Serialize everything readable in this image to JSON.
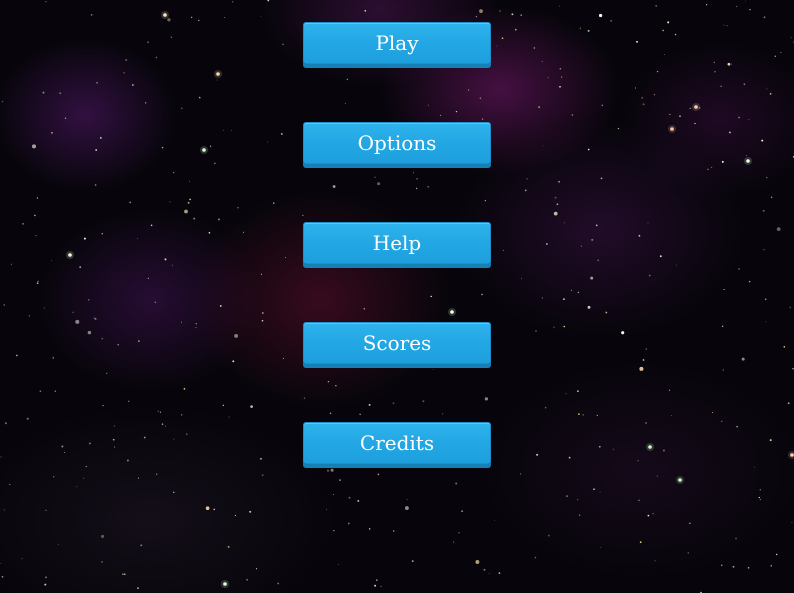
{
  "main_menu": {
    "buttons": [
      {
        "id": "play",
        "label": "Play"
      },
      {
        "id": "options",
        "label": "Options"
      },
      {
        "id": "help",
        "label": "Help"
      },
      {
        "id": "scores",
        "label": "Scores"
      },
      {
        "id": "credits",
        "label": "Credits"
      }
    ]
  },
  "theme": {
    "button_color": "#22a6e4",
    "button_shadow": "#167fb6",
    "button_text": "#ffffff",
    "background": "#07050b"
  }
}
